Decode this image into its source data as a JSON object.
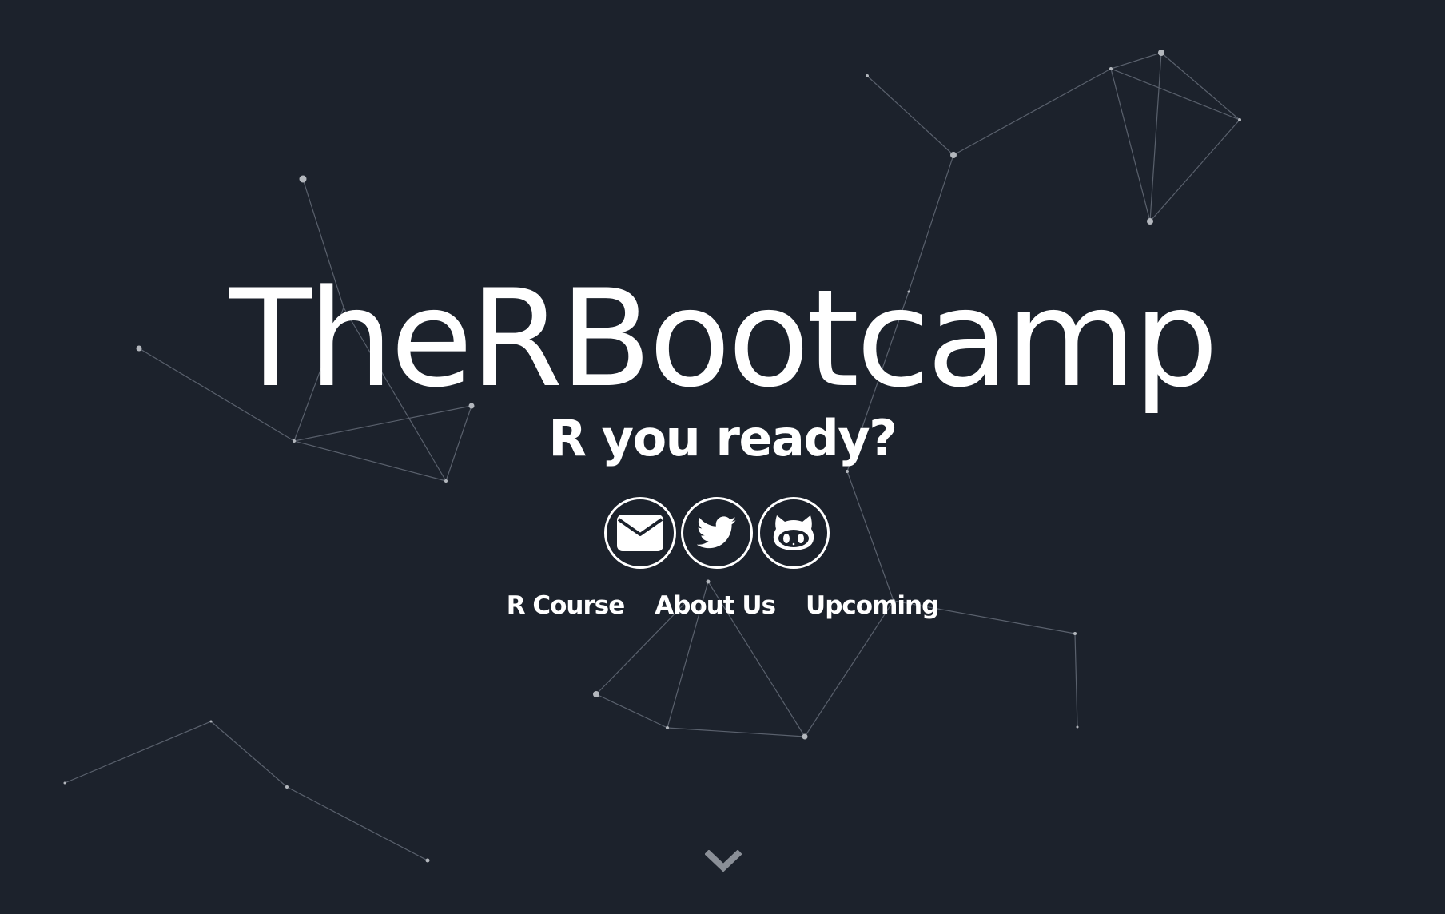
{
  "hero": {
    "title": "TheRBootcamp",
    "subtitle": "R you ready?",
    "background_color": "#1c222c",
    "text_color": "#ffffff",
    "line_color": "#5a616d",
    "node_color": "#b3b7bd"
  },
  "social": [
    {
      "name": "email",
      "icon": "envelope-icon"
    },
    {
      "name": "twitter",
      "icon": "twitter-bird-icon"
    },
    {
      "name": "github",
      "icon": "github-octocat-icon"
    }
  ],
  "nav": {
    "r_course": "R Course",
    "about_us": "About Us",
    "upcoming": "Upcoming"
  },
  "scroll": {
    "icon": "chevron-down-icon",
    "color": "#8a8f97"
  }
}
